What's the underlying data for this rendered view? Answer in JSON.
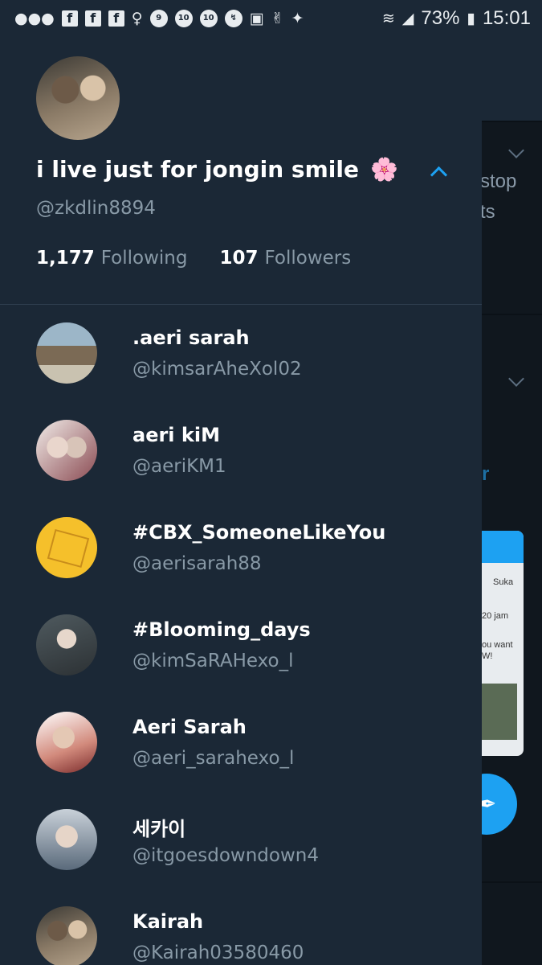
{
  "status_bar": {
    "notification_icons": [
      "chat-bubble-icon",
      "facebook-icon",
      "facebook-icon",
      "facebook-icon",
      "mother-baby-icon",
      "nine-icon",
      "ten-icon",
      "ten-icon",
      "messenger-icon",
      "instagram-icon",
      "v-live-icon",
      "twitter-icon"
    ],
    "battery": "73%",
    "time": "15:01"
  },
  "background": {
    "text_stop": "stop",
    "text_ts": "ts",
    "text_r": "r",
    "card_tab": "Suka",
    "card_time": "20 jam",
    "card_line1": "ou want",
    "card_line2": "W!"
  },
  "profile": {
    "display_name": "i live just for jongin smile",
    "emoji": "🌸",
    "handle": "@zkdlin8894",
    "following_count": "1,177",
    "following_label": "Following",
    "followers_count": "107",
    "followers_label": "Followers"
  },
  "accounts": [
    {
      "name": ".aeri sarah",
      "handle": "@kimsarAheXol02"
    },
    {
      "name": "aeri kiM",
      "handle": "@aeriKM1"
    },
    {
      "name": "#CBX_SomeoneLikeYou",
      "handle": "@aerisarah88"
    },
    {
      "name": "#Blooming_days",
      "handle": "@kimSaRAHexo_l"
    },
    {
      "name": "Aeri Sarah",
      "handle": "@aeri_sarahexo_l"
    },
    {
      "name": "세카이",
      "handle": "@itgoesdowndown4"
    },
    {
      "name": "Kairah",
      "handle": "@Kairah03580460"
    }
  ],
  "colors": {
    "accent": "#1da1f2",
    "drawer_bg": "#1b2836",
    "secondary_text": "#8899a6"
  }
}
